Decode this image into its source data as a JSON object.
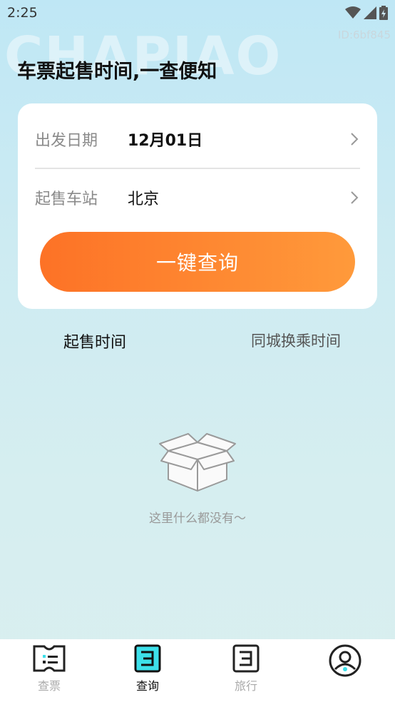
{
  "status_bar": {
    "time": "2:25"
  },
  "device_id": "ID:6bf845",
  "watermark": "CHAPIAO",
  "headline": "车票起售时间,一查便知",
  "form": {
    "date_label": "出发日期",
    "date_value": "12月01日",
    "station_label": "起售车站",
    "station_value": "北京",
    "query_button": "一键查询"
  },
  "tabs": [
    {
      "label": "起售时间",
      "active": true
    },
    {
      "label": "同城换乘时间",
      "active": false
    }
  ],
  "empty_state": {
    "message": "这里什么都没有～"
  },
  "bottom_nav": [
    {
      "label": "查票",
      "icon": "ticket-icon",
      "active": false
    },
    {
      "label": "查询",
      "icon": "search-doc-icon",
      "active": true
    },
    {
      "label": "旅行",
      "icon": "travel-doc-icon",
      "active": false
    },
    {
      "label": "",
      "icon": "profile-icon",
      "active": false
    }
  ],
  "colors": {
    "accent_orange": "#fd7226",
    "accent_cyan": "#3de0ea"
  }
}
